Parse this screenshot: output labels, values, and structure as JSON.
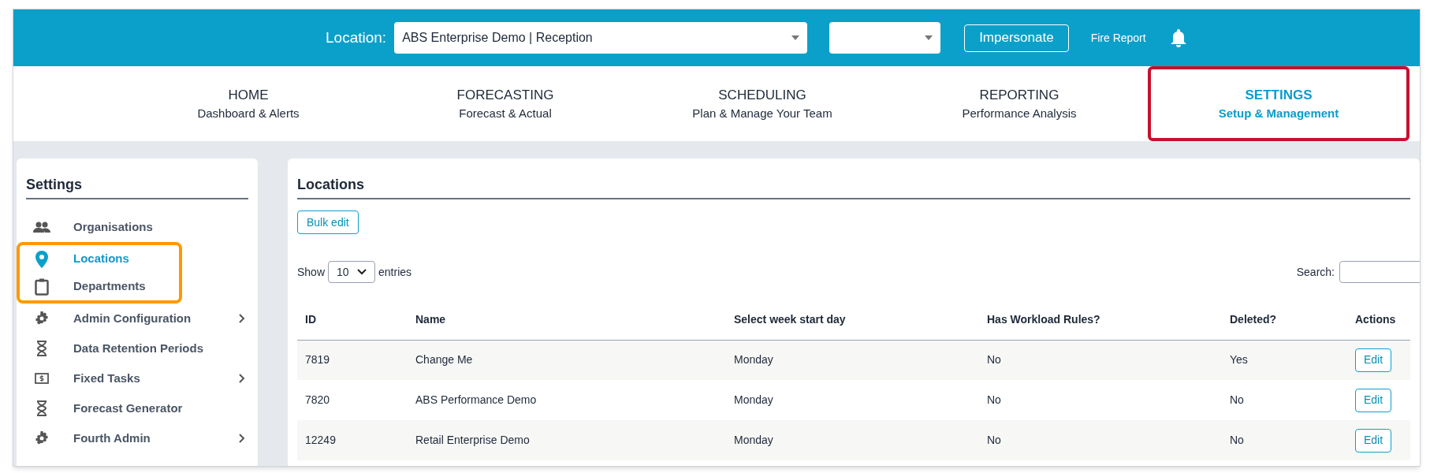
{
  "top_bar": {
    "location_label": "Location:",
    "location_value": "ABS Enterprise Demo | Reception",
    "impersonate_button": "Impersonate",
    "fire_report_link": "Fire Report"
  },
  "nav": [
    {
      "title": "HOME",
      "subtitle": "Dashboard & Alerts",
      "selected": false,
      "highlighted": false
    },
    {
      "title": "FORECASTING",
      "subtitle": "Forecast & Actual",
      "selected": false,
      "highlighted": false
    },
    {
      "title": "SCHEDULING",
      "subtitle": "Plan & Manage Your Team",
      "selected": false,
      "highlighted": false
    },
    {
      "title": "REPORTING",
      "subtitle": "Performance Analysis",
      "selected": false,
      "highlighted": false
    },
    {
      "title": "SETTINGS",
      "subtitle": "Setup & Management",
      "selected": true,
      "highlighted": true
    }
  ],
  "sidebar": {
    "title": "Settings",
    "items": [
      {
        "label": "Organisations",
        "selected": false,
        "has_submenu": false,
        "highlighted": false
      },
      {
        "label": "Locations",
        "selected": true,
        "has_submenu": false,
        "highlighted": true
      },
      {
        "label": "Departments",
        "selected": false,
        "has_submenu": false,
        "highlighted": true
      },
      {
        "label": "Admin Configuration",
        "selected": false,
        "has_submenu": true,
        "highlighted": false
      },
      {
        "label": "Data Retention Periods",
        "selected": false,
        "has_submenu": false,
        "highlighted": false
      },
      {
        "label": "Fixed Tasks",
        "selected": false,
        "has_submenu": true,
        "highlighted": false
      },
      {
        "label": "Forecast Generator",
        "selected": false,
        "has_submenu": false,
        "highlighted": false
      },
      {
        "label": "Fourth Admin",
        "selected": false,
        "has_submenu": true,
        "highlighted": false
      }
    ]
  },
  "main": {
    "title": "Locations",
    "bulk_edit_button": "Bulk edit",
    "show_label": "Show",
    "page_size": "10",
    "entries_label": "entries",
    "search_label": "Search:",
    "table": {
      "columns": [
        "ID",
        "Name",
        "Select week start day",
        "Has Workload Rules?",
        "Deleted?",
        "Actions"
      ],
      "rows": [
        {
          "cells": [
            "7819",
            "Change Me",
            "Monday",
            "No",
            "Yes"
          ],
          "action": "Edit"
        },
        {
          "cells": [
            "7820",
            "ABS Performance Demo",
            "Monday",
            "No",
            "No"
          ],
          "action": "Edit"
        },
        {
          "cells": [
            "12249",
            "Retail Enterprise Demo",
            "Monday",
            "No",
            "No"
          ],
          "action": "Edit"
        }
      ]
    }
  }
}
